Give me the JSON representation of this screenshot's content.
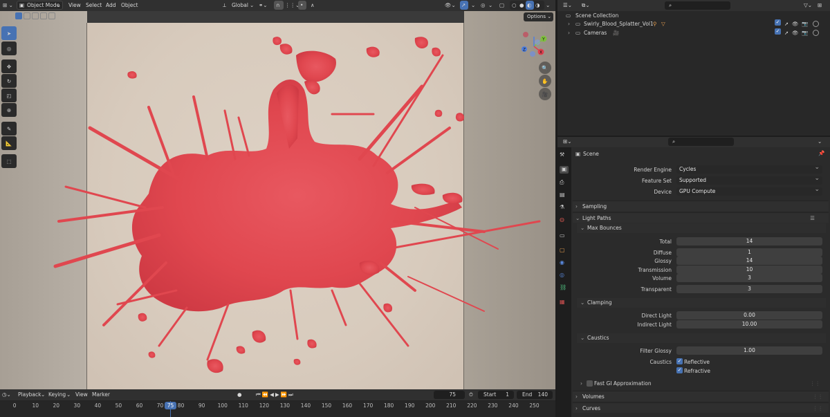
{
  "viewport": {
    "mode": "Object Mode",
    "menu": [
      "View",
      "Select",
      "Add",
      "Object"
    ],
    "transform_orientation": "Global",
    "options_label": "Options"
  },
  "outliner": {
    "root": "Scene Collection",
    "items": [
      {
        "label": "Swirly_Blood_Splatter_Vol1"
      },
      {
        "label": "Cameras"
      }
    ]
  },
  "properties": {
    "scene_label": "Scene",
    "render_engine": {
      "label": "Render Engine",
      "value": "Cycles"
    },
    "feature_set": {
      "label": "Feature Set",
      "value": "Supported"
    },
    "device": {
      "label": "Device",
      "value": "GPU Compute"
    },
    "panels": {
      "sampling": "Sampling",
      "light_paths": "Light Paths",
      "max_bounces": "Max Bounces",
      "clamping": "Clamping",
      "caustics": "Caustics",
      "fast_gi": "Fast GI Approximation",
      "volumes": "Volumes",
      "curves": "Curves"
    },
    "bounces": [
      {
        "label": "Total",
        "value": "14"
      },
      {
        "label": "Diffuse",
        "value": "1"
      },
      {
        "label": "Glossy",
        "value": "14"
      },
      {
        "label": "Transmission",
        "value": "10"
      },
      {
        "label": "Volume",
        "value": "3"
      },
      {
        "label": "Transparent",
        "value": "3"
      }
    ],
    "clamping_fields": [
      {
        "label": "Direct Light",
        "value": "0.00"
      },
      {
        "label": "Indirect Light",
        "value": "10.00"
      }
    ],
    "filter_glossy": {
      "label": "Filter Glossy",
      "value": "1.00"
    },
    "caustics_label": "Caustics",
    "reflective": "Reflective",
    "refractive": "Refractive"
  },
  "timeline": {
    "menu": [
      "Playback",
      "Keying",
      "View",
      "Marker"
    ],
    "current_frame": "75",
    "start_label": "Start",
    "start": "1",
    "end_label": "End",
    "end": "140",
    "ticks": [
      "0",
      "10",
      "20",
      "30",
      "40",
      "50",
      "60",
      "70",
      "80",
      "90",
      "100",
      "110",
      "120",
      "130",
      "140",
      "150",
      "160",
      "170",
      "180",
      "190",
      "200",
      "210",
      "220",
      "230",
      "240",
      "250"
    ],
    "playhead": "75"
  },
  "colors": {
    "accent": "#4772b3",
    "splatter": "#e0474f",
    "background": "#d9ccbe"
  }
}
